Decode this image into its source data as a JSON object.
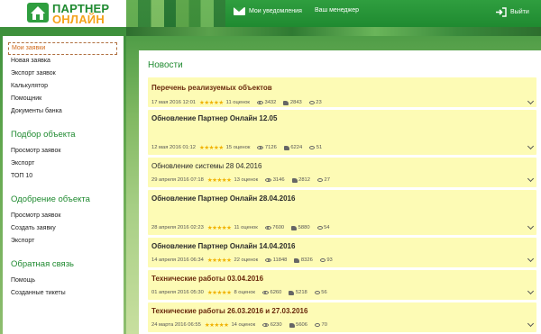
{
  "header": {
    "logo_line1": "ПАРТНЕР",
    "logo_line2": "ОНЛАЙН",
    "notifications_label": "Мои уведомления",
    "manager_label": "Ваш менеджер",
    "exit_label": "Выйти"
  },
  "sidebar": {
    "group1": [
      {
        "label": "Мои заявки",
        "active": true
      },
      {
        "label": "Новая заявка"
      },
      {
        "label": "Экспорт заявок"
      },
      {
        "label": "Калькулятор"
      },
      {
        "label": "Помощник"
      },
      {
        "label": "Документы банка"
      }
    ],
    "section2_title": "Подбор объекта",
    "group2": [
      {
        "label": "Просмотр заявок"
      },
      {
        "label": "Экспорт"
      },
      {
        "label": "ТОП 10"
      }
    ],
    "section3_title": "Одобрение объекта",
    "group3": [
      {
        "label": "Просмотр заявок"
      },
      {
        "label": "Создать заявку"
      },
      {
        "label": "Экспорт"
      }
    ],
    "section4_title": "Обратная связь",
    "group4": [
      {
        "label": "Помощь"
      },
      {
        "label": "Созданные тикеты"
      }
    ]
  },
  "main": {
    "title": "Новости",
    "news": [
      {
        "title": "Перечень реализуемых объектов",
        "date": "17 мая 2016 12:01",
        "stars": "★★★★★",
        "ratings": "11 оценок",
        "views": "3432",
        "likes": "2843",
        "comments": "23"
      },
      {
        "title": "Обновление Партнер Онлайн 12.05",
        "date": "12 мая 2016 01:12",
        "stars": "★★★★★",
        "ratings": "15 оценок",
        "views": "7126",
        "likes": "6224",
        "comments": "51"
      },
      {
        "title": "Обновление системы 28 04.2016",
        "date": "29 апреля 2016 07:18",
        "stars": "★★★★★",
        "ratings": "13 оценок",
        "views": "3146",
        "likes": "2812",
        "comments": "27"
      },
      {
        "title": "Обновление Партнер Онлайн 28.04.2016",
        "date": "28 апреля 2016 02:23",
        "stars": "★★★★★",
        "ratings": "11 оценок",
        "views": "7600",
        "likes": "5880",
        "comments": "54"
      },
      {
        "title": "Обновление Партнер Онлайн 14.04.2016",
        "date": "14 апреля 2016 06:34",
        "stars": "★★★★★",
        "ratings": "22 оценок",
        "views": "11848",
        "likes": "8326",
        "comments": "93"
      },
      {
        "title": "Технические работы 03.04.2016",
        "date": "01 апреля 2016 05:30",
        "stars": "★★★★★",
        "ratings": "8 оценок",
        "views": "6260",
        "likes": "5218",
        "comments": "56"
      },
      {
        "title": "Технические работы 26.03.2016 и 27.03.2016",
        "date": "24 марта 2016 06:55",
        "stars": "★★★★★",
        "ratings": "14 оценок",
        "views": "6230",
        "likes": "5606",
        "comments": "70"
      }
    ]
  },
  "colors": {
    "brand_green": "#1f8a30",
    "brand_orange": "#f4a21a",
    "news_bg": "#fdfbb5",
    "active_item": "#d26a1a"
  }
}
